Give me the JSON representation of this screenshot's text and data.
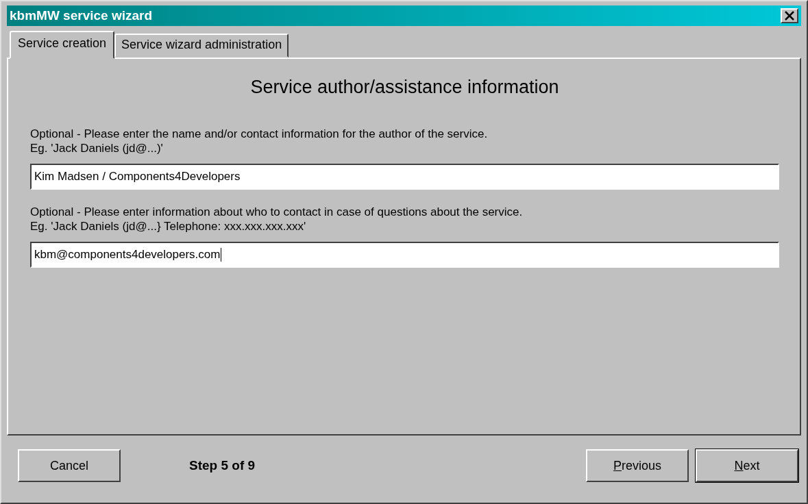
{
  "window": {
    "title": "kbmMW service wizard"
  },
  "tabs": [
    {
      "label": "Service creation",
      "selected": true
    },
    {
      "label": "Service wizard administration",
      "selected": false
    }
  ],
  "heading": "Service author/assistance information",
  "fields": [
    {
      "hint_lines": [
        "Optional - Please enter the name and/or contact information for the author of the service.",
        "Eg. 'Jack Daniels (jd@...)'"
      ],
      "value": "Kim Madsen / Components4Developers",
      "focused": false
    },
    {
      "hint_lines": [
        "Optional - Please enter information about who to contact in case of questions about the service.",
        "Eg. 'Jack Daniels (jd@...} Telephone: xxx.xxx.xxx.xxx'"
      ],
      "value": "kbm@components4developers.com",
      "focused": true
    }
  ],
  "cancel_button": {
    "label": "Cancel",
    "mnemonic": false
  },
  "step": "Step 5 of 9",
  "nav_buttons": [
    {
      "label": "Previous",
      "mnemonic": true,
      "default": false
    },
    {
      "label": "Next",
      "mnemonic": true,
      "default": true
    }
  ]
}
